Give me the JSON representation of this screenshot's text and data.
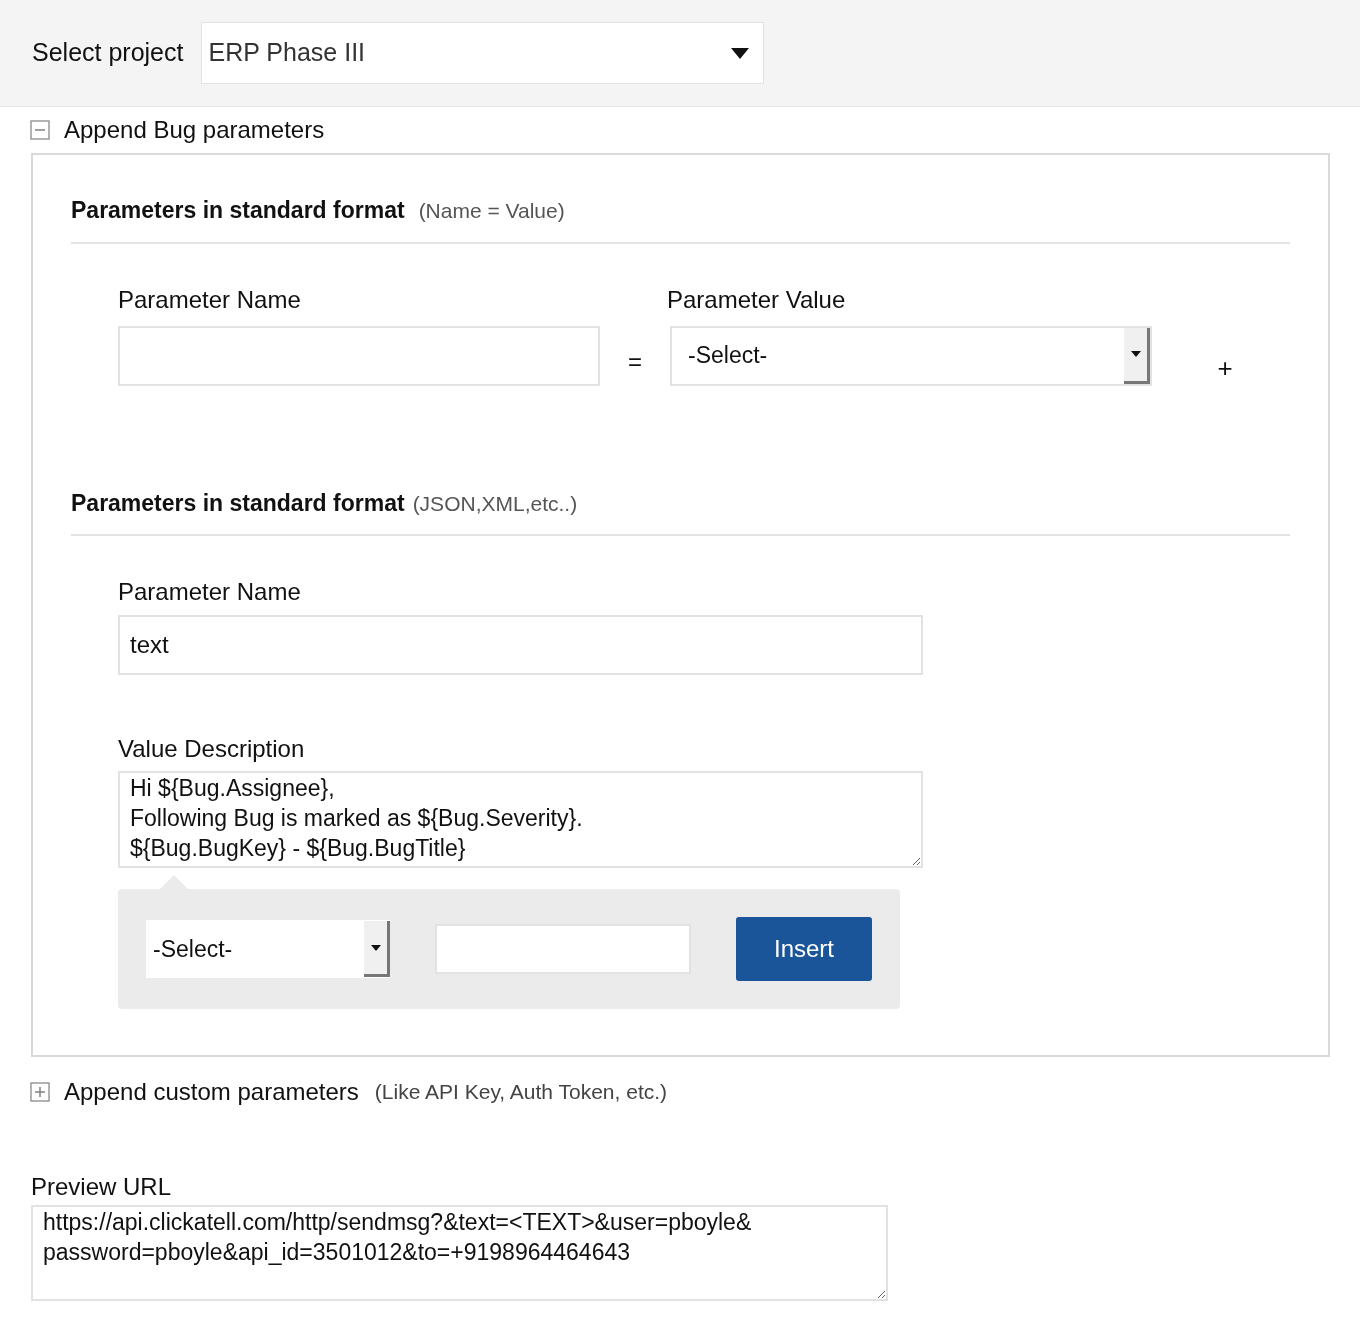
{
  "project_bar": {
    "label": "Select project",
    "value": "ERP Phase III"
  },
  "bug_section": {
    "title": "Append Bug parameters",
    "expanded": true,
    "standard": {
      "title": "Parameters in standard format",
      "hint": "(Name = Value)",
      "name_label": "Parameter Name",
      "value_label": "Parameter Value",
      "equals": "=",
      "value_select": "-Select-",
      "add": "+"
    },
    "structured": {
      "title": "Parameters in standard format",
      "hint": "(JSON,XML,etc..)",
      "name_label": "Parameter Name",
      "name_value": "text",
      "description_label": "Value Description",
      "description_lines": [
        "Hi ${Bug.Assignee},",
        "Following Bug is marked as ${Bug.Severity}.",
        "${Bug.BugKey} - ${Bug.BugTitle}"
      ],
      "insert_bar": {
        "select": "-Select-",
        "button": "Insert"
      }
    }
  },
  "custom_section": {
    "title": "Append custom parameters",
    "hint": "(Like API Key, Auth Token, etc.)",
    "expanded": false
  },
  "preview": {
    "label": "Preview URL",
    "lines": [
      "https://api.clickatell.com/http/sendmsg?&text=<TEXT>&user=pboyle&",
      "password=pboyle&api_id=3501012&to=+9198964464643"
    ]
  }
}
